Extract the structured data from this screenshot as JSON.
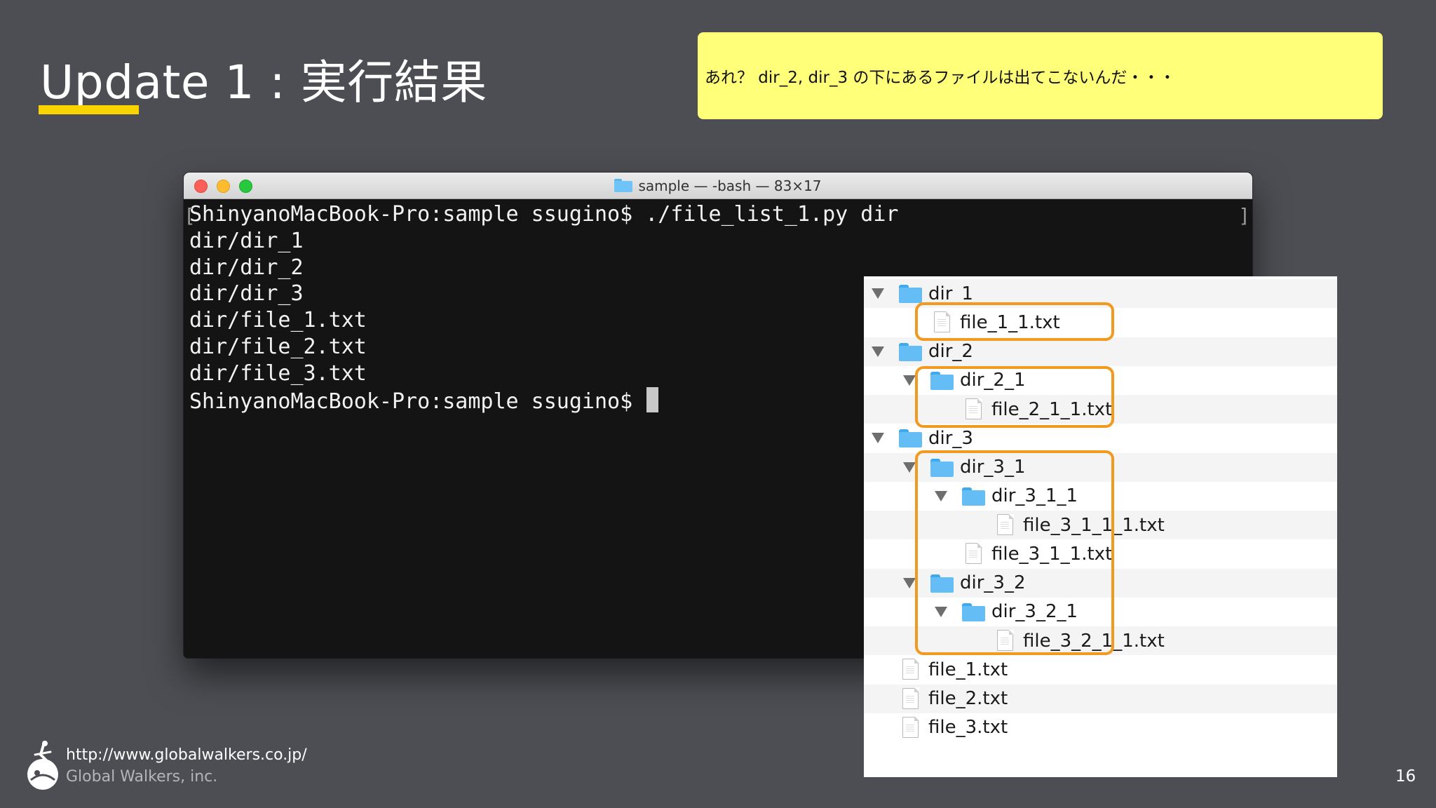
{
  "slide": {
    "title": "Update 1 : 実行結果",
    "note": "あれ？ dir_2, dir_3 の下にあるファイルは出てこないんだ・・・",
    "page_number": "16",
    "accent_color": "#f9d400",
    "note_color": "#ffff7a"
  },
  "terminal": {
    "window_title": "sample — -bash — 83×17",
    "lines": [
      "ShinyanoMacBook-Pro:sample ssugino$ ./file_list_1.py dir",
      "dir/dir_1",
      "dir/dir_2",
      "dir/dir_3",
      "dir/file_1.txt",
      "dir/file_2.txt",
      "dir/file_3.txt",
      "ShinyanoMacBook-Pro:sample ssugino$ "
    ]
  },
  "finder": {
    "highlight_color": "#f29a1f",
    "rows": [
      {
        "name": "dir_1",
        "type": "folder",
        "depth": 0,
        "expanded": true
      },
      {
        "name": "file_1_1.txt",
        "type": "file",
        "depth": 1
      },
      {
        "name": "dir_2",
        "type": "folder",
        "depth": 0,
        "expanded": true
      },
      {
        "name": "dir_2_1",
        "type": "folder",
        "depth": 1,
        "expanded": true
      },
      {
        "name": "file_2_1_1.txt",
        "type": "file",
        "depth": 2
      },
      {
        "name": "dir_3",
        "type": "folder",
        "depth": 0,
        "expanded": true
      },
      {
        "name": "dir_3_1",
        "type": "folder",
        "depth": 1,
        "expanded": true
      },
      {
        "name": "dir_3_1_1",
        "type": "folder",
        "depth": 2,
        "expanded": true
      },
      {
        "name": "file_3_1_1_1.txt",
        "type": "file",
        "depth": 3
      },
      {
        "name": "file_3_1_1.txt",
        "type": "file",
        "depth": 2
      },
      {
        "name": "dir_3_2",
        "type": "folder",
        "depth": 1,
        "expanded": true
      },
      {
        "name": "dir_3_2_1",
        "type": "folder",
        "depth": 2,
        "expanded": true
      },
      {
        "name": "file_3_2_1_1.txt",
        "type": "file",
        "depth": 3
      },
      {
        "name": "file_1.txt",
        "type": "file",
        "depth": 0
      },
      {
        "name": "file_2.txt",
        "type": "file",
        "depth": 0
      },
      {
        "name": "file_3.txt",
        "type": "file",
        "depth": 0
      }
    ]
  },
  "footer": {
    "url": "http://www.globalwalkers.co.jp/",
    "company": "Global Walkers, inc."
  }
}
